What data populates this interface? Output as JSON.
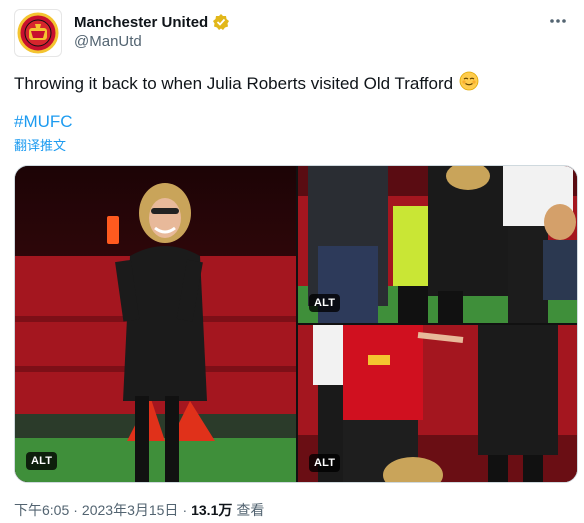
{
  "account": {
    "name": "Manchester United",
    "handle": "@ManUtd",
    "verified_color": "#e2b719"
  },
  "tweet": {
    "text": "Throwing it back to when Julia Roberts visited Old Trafford",
    "emoji": "relieved-face",
    "hashtag": "#MUFC",
    "translate_label": "翻译推文"
  },
  "media": {
    "alt_label": "ALT",
    "photos": [
      {
        "id": "photo-1",
        "alt_badge": true
      },
      {
        "id": "photo-2",
        "alt_badge": true
      },
      {
        "id": "photo-3",
        "alt_badge": true
      }
    ]
  },
  "meta": {
    "time": "下午6:05",
    "separator": "·",
    "date": "2023年3月15日",
    "views_count": "13.1万",
    "views_label": "查看"
  },
  "colors": {
    "link": "#1d9bf0",
    "secondary_text": "#536471",
    "stadium_red": "#a4161f",
    "pitch_green": "#3f8f3a"
  }
}
